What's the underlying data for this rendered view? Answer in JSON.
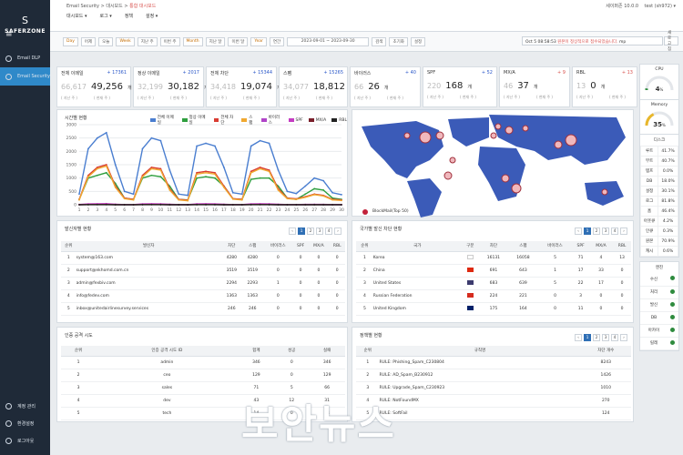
{
  "app": {
    "logo": "SAFERZONE",
    "logo_mark": "S"
  },
  "sidebar": {
    "items": [
      {
        "label": "Email DLP",
        "active": false
      },
      {
        "label": "Email Security",
        "active": true
      }
    ],
    "bottom": [
      {
        "label": "계정 관리"
      },
      {
        "label": "환경설정"
      },
      {
        "label": "로그아웃"
      }
    ]
  },
  "topbar": {
    "breadcrumb": "Email Security > 대시보드 > ",
    "breadcrumb_current": "통합 대시보드",
    "right": "세이퍼존 10.0.0",
    "user": "test (sh972) ▾",
    "menus": [
      "대시보드 ▾",
      "로그 ▾",
      "정책",
      "설정 ▾"
    ]
  },
  "filters": {
    "items": [
      "Day",
      "어제",
      "오늘",
      "Week",
      "지난 주",
      "이번 주",
      "Month",
      "지난 달",
      "이번 달",
      "Year",
      "연간"
    ],
    "date": "2023-09-01 ~ 2023-09-30",
    "search": "검색",
    "reset": "초기화",
    "settings": "설정",
    "ticker_time": "Oct 5 08:58:53",
    "ticker_text": " 원본이 정상적으로 접수되었습니다. ",
    "ticker_tag": "mp",
    "refresh": "새로 고침"
  },
  "stats": [
    {
      "title": "전체 이메일",
      "delta": "+ 17361",
      "dir": "up",
      "prev": "66,617",
      "cur": "49,256",
      "unit": "개",
      "sub1": "( 지난 주 )",
      "sub2": "( 현재 주 )"
    },
    {
      "title": "정상 이메일",
      "delta": "+ 2017",
      "dir": "up",
      "prev": "32,199",
      "cur": "30,182",
      "unit": "개",
      "sub1": "( 지난 주 )",
      "sub2": "( 현재 주 )"
    },
    {
      "title": "전체 차단",
      "delta": "+ 15344",
      "dir": "up",
      "prev": "34,418",
      "cur": "19,074",
      "unit": "개",
      "sub1": "( 지난 주 )",
      "sub2": "( 현재 주 )"
    },
    {
      "title": "스팸",
      "delta": "+ 15265",
      "dir": "up",
      "prev": "34,077",
      "cur": "18,812",
      "unit": "개",
      "sub1": "( 지난 주 )",
      "sub2": "( 현재 주 )"
    },
    {
      "title": "바이러스",
      "delta": "+ 40",
      "dir": "up",
      "prev": "66",
      "cur": "26",
      "unit": "개",
      "sub1": "( 지난 주 )",
      "sub2": "( 현재 주 )"
    },
    {
      "title": "SPF",
      "delta": "+ 52",
      "dir": "up",
      "prev": "220",
      "cur": "168",
      "unit": "개",
      "sub1": "( 지난 주 )",
      "sub2": "( 현재 주 )"
    },
    {
      "title": "MX/A",
      "delta": "+ 9",
      "dir": "dn",
      "prev": "46",
      "cur": "37",
      "unit": "개",
      "sub1": "( 지난 주 )",
      "sub2": "( 현재 주 )"
    },
    {
      "title": "RBL",
      "delta": "+ 13",
      "dir": "dn",
      "prev": "13",
      "cur": "0",
      "unit": "개",
      "sub1": "( 지난 주 )",
      "sub2": "( 현재 주 )"
    }
  ],
  "timeline": {
    "title": "시간별 현황",
    "legend_label": "BlockMail(Top 50)"
  },
  "chart_data": {
    "type": "line",
    "x": [
      1,
      2,
      3,
      4,
      5,
      6,
      7,
      8,
      9,
      10,
      11,
      12,
      13,
      14,
      15,
      16,
      17,
      18,
      19,
      20,
      21,
      22,
      23,
      24,
      25,
      26,
      27,
      28,
      29,
      30
    ],
    "ylim": [
      0,
      3000
    ],
    "yticks": [
      0,
      500,
      1000,
      1500,
      2000,
      2500,
      3000
    ],
    "series": [
      {
        "name": "전체 이메일",
        "color": "#4a7ed0",
        "values": [
          400,
          2100,
          2500,
          2700,
          1500,
          500,
          400,
          2100,
          2500,
          2400,
          1300,
          400,
          350,
          2200,
          2300,
          2200,
          1400,
          450,
          400,
          2200,
          2400,
          2300,
          1300,
          500,
          420,
          700,
          1000,
          900,
          450,
          380
        ]
      },
      {
        "name": "정상 이메일",
        "color": "#2e9e3e",
        "values": [
          200,
          1000,
          1100,
          1200,
          800,
          250,
          200,
          1000,
          1100,
          1050,
          700,
          200,
          180,
          1000,
          1050,
          1000,
          700,
          220,
          200,
          950,
          1000,
          1000,
          700,
          250,
          200,
          400,
          600,
          550,
          250,
          200
        ]
      },
      {
        "name": "전체 차단",
        "color": "#d93c32",
        "values": [
          200,
          1100,
          1400,
          1500,
          700,
          250,
          200,
          1100,
          1400,
          1350,
          600,
          200,
          170,
          1200,
          1250,
          1200,
          700,
          230,
          200,
          1250,
          1400,
          1300,
          600,
          250,
          220,
          300,
          400,
          350,
          200,
          180
        ]
      },
      {
        "name": "스팸",
        "color": "#f0a830",
        "values": [
          180,
          1050,
          1350,
          1450,
          650,
          230,
          180,
          1050,
          1350,
          1300,
          550,
          180,
          150,
          1150,
          1200,
          1150,
          650,
          210,
          180,
          1200,
          1350,
          1250,
          550,
          230,
          200,
          280,
          380,
          330,
          180,
          160
        ]
      },
      {
        "name": "바이러스",
        "color": "#b044c8",
        "values": [
          5,
          10,
          8,
          12,
          6,
          3,
          4,
          9,
          10,
          8,
          5,
          3,
          3,
          10,
          9,
          8,
          5,
          3,
          3,
          9,
          10,
          8,
          5,
          3,
          3,
          4,
          6,
          5,
          3,
          3
        ]
      },
      {
        "name": "SPF",
        "color": "#c43cc2",
        "values": [
          10,
          30,
          35,
          40,
          20,
          8,
          8,
          30,
          35,
          32,
          18,
          8,
          7,
          32,
          33,
          30,
          18,
          8,
          7,
          30,
          33,
          32,
          18,
          8,
          7,
          12,
          15,
          14,
          8,
          7
        ]
      },
      {
        "name": "MX/A",
        "color": "#7a1f2b",
        "values": [
          3,
          8,
          9,
          10,
          5,
          2,
          2,
          8,
          9,
          8,
          4,
          2,
          2,
          8,
          8,
          8,
          4,
          2,
          2,
          8,
          9,
          8,
          4,
          2,
          2,
          3,
          4,
          3,
          2,
          2
        ]
      },
      {
        "name": "RBL",
        "color": "#222222",
        "values": [
          0,
          2,
          3,
          3,
          1,
          0,
          0,
          2,
          3,
          2,
          1,
          0,
          0,
          2,
          2,
          2,
          1,
          0,
          0,
          2,
          3,
          2,
          1,
          0,
          0,
          1,
          1,
          1,
          0,
          0
        ]
      }
    ]
  },
  "senders": {
    "title": "발신자별 현황",
    "pages": [
      "‹",
      "1",
      "2",
      "3",
      "4",
      "›"
    ],
    "headers": [
      "순위",
      "발신자",
      "차단",
      "스팸",
      "바이러스",
      "SPF",
      "MX/A",
      "RBL"
    ],
    "rows": [
      [
        "1",
        "system@163.com",
        "4280",
        "4280",
        "0",
        "0",
        "0",
        "0"
      ],
      [
        "2",
        "support@ekhomd.com.cn",
        "3519",
        "3519",
        "0",
        "0",
        "0",
        "0"
      ],
      [
        "3",
        "admin@fexbiv.com",
        "2294",
        "2293",
        "1",
        "0",
        "0",
        "0"
      ],
      [
        "4",
        "info@fedev.com",
        "1363",
        "1363",
        "0",
        "0",
        "0",
        "0"
      ],
      [
        "5",
        "inbox@unitedairlinesurvey.services",
        "246",
        "246",
        "0",
        "0",
        "0",
        "0"
      ]
    ]
  },
  "countries": {
    "title": "국가별 발신 차단 현황",
    "pages": [
      "‹",
      "1",
      "2",
      "3",
      "4",
      "›"
    ],
    "headers": [
      "순위",
      "국가",
      "구분",
      "차단",
      "스팸",
      "바이러스",
      "SPF",
      "MX/A",
      "RBL"
    ],
    "rows": [
      [
        "1",
        "Korea",
        "kr",
        "16131",
        "16058",
        "5",
        "71",
        "4",
        "13"
      ],
      [
        "2",
        "China",
        "cn",
        "691",
        "643",
        "1",
        "17",
        "33",
        "0"
      ],
      [
        "3",
        "United States",
        "us",
        "683",
        "639",
        "5",
        "22",
        "17",
        "0"
      ],
      [
        "4",
        "Russian Federation",
        "ru",
        "224",
        "221",
        "0",
        "3",
        "0",
        "0"
      ],
      [
        "5",
        "United Kingdom",
        "gb",
        "175",
        "164",
        "0",
        "11",
        "0",
        "0"
      ]
    ]
  },
  "intrusion": {
    "title": "인증 공격 시도",
    "headers": [
      "순위",
      "인증 공격 시도 ID",
      "합계",
      "성공",
      "실패"
    ],
    "rows": [
      [
        "1",
        "admin",
        "346",
        "0",
        "346"
      ],
      [
        "2",
        "ceo",
        "129",
        "0",
        "129"
      ],
      [
        "3",
        "sales",
        "71",
        "5",
        "66"
      ],
      [
        "4",
        "dev",
        "43",
        "12",
        "31"
      ],
      [
        "5",
        "tech",
        "14",
        "0",
        "14"
      ]
    ]
  },
  "policies": {
    "title": "정책별 현황",
    "pages": [
      "‹",
      "1",
      "2",
      "3",
      "4",
      "›"
    ],
    "headers": [
      "순위",
      "규칙명",
      "차단 개수"
    ],
    "rows": [
      [
        "1",
        "RULE: Phishing_Spam_C230804",
        "8243"
      ],
      [
        "2",
        "RULE: AD_Spam_B230912",
        "1426"
      ],
      [
        "3",
        "RULE: Upgrade_Spam_C230923",
        "1010"
      ],
      [
        "4",
        "RULE: NotFoundMX",
        "270"
      ],
      [
        "5",
        "RULE: SoftFail",
        "124"
      ]
    ]
  },
  "system": {
    "cpu_label": "CPU",
    "cpu_value": "4",
    "cpu_unit": "%",
    "mem_label": "Memory",
    "mem_value": "35",
    "mem_unit": "%",
    "disk_title": "디스크",
    "disks": [
      [
        "루트",
        "41.7%"
      ],
      [
        "부트",
        "40.7%"
      ],
      [
        "템프",
        "0.0%"
      ],
      [
        "DB",
        "18.0%"
      ],
      [
        "설정",
        "30.1%"
      ],
      [
        "로그",
        "81.8%"
      ],
      [
        "홈",
        "46.4%"
      ],
      [
        "아웃큐",
        "4.2%"
      ],
      [
        "인큐",
        "0.3%"
      ],
      [
        "원본",
        "70.9%"
      ],
      [
        "캐시",
        "0.6%"
      ]
    ],
    "engine_title": "엔진",
    "engines": [
      "수신",
      "처리",
      "발신",
      "DB",
      "아카이",
      "릴레"
    ]
  },
  "watermark": "보안뉴스"
}
